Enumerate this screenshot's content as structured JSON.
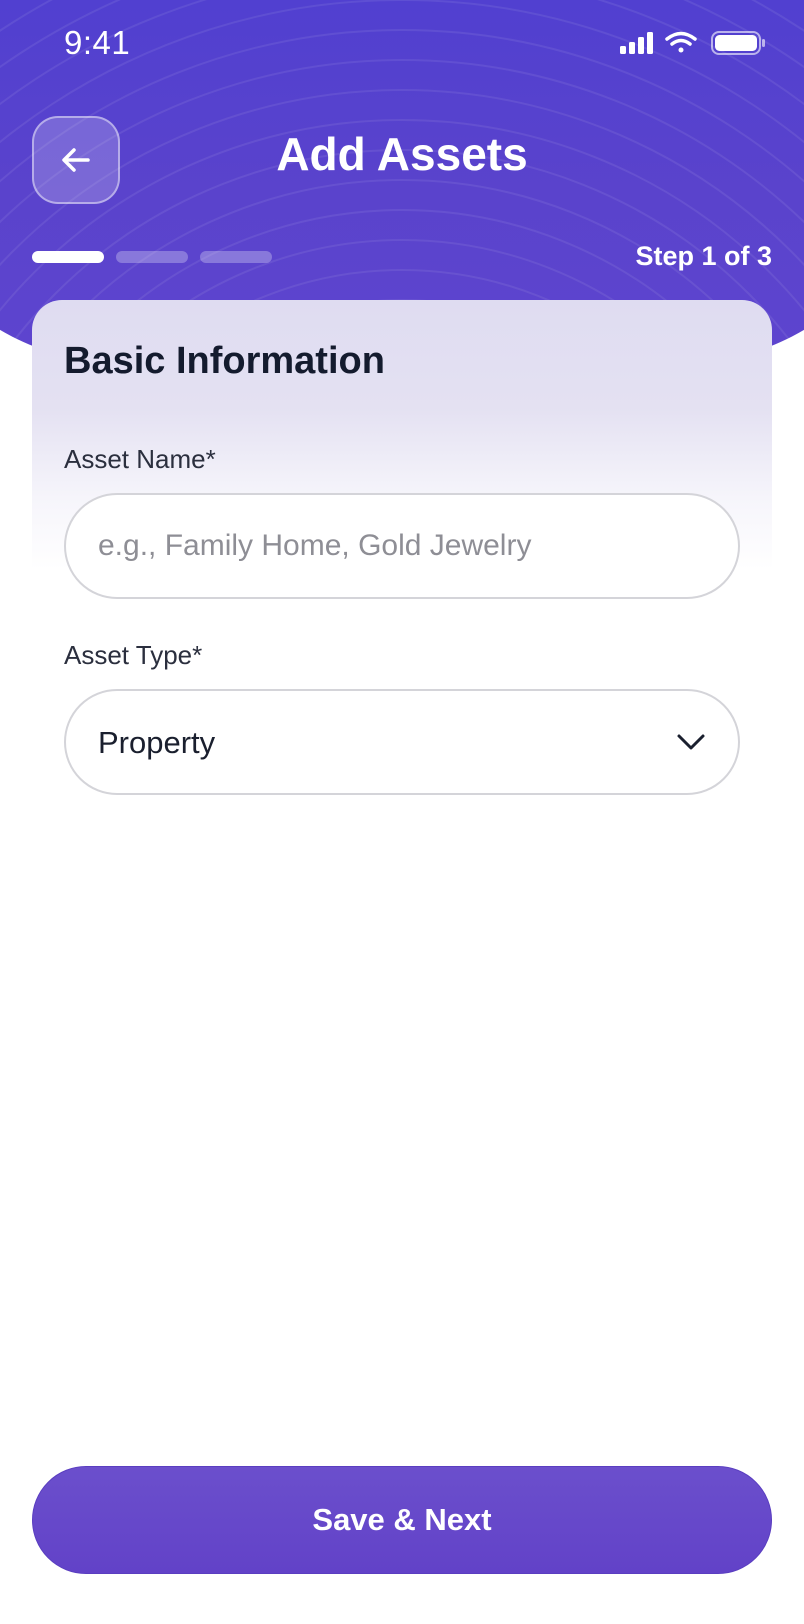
{
  "status_bar": {
    "time": "9:41",
    "icons": [
      "cellular-signal-icon",
      "wifi-icon",
      "battery-icon"
    ]
  },
  "header": {
    "title": "Add Assets",
    "back_icon": "arrow-left-icon",
    "step_label": "Step 1 of 3",
    "progress": {
      "current_step": 1,
      "total_steps": 3
    }
  },
  "form": {
    "section_title": "Basic Information",
    "asset_name": {
      "label": "Asset Name*",
      "value": "",
      "placeholder": "e.g., Family Home, Gold Jewelry"
    },
    "asset_type": {
      "label": "Asset Type*",
      "selected": "Property",
      "icon": "chevron-down-icon"
    }
  },
  "footer": {
    "primary_button": "Save & Next"
  },
  "colors": {
    "header_purple": "#5a43cc",
    "button_purple": "#6647c9",
    "text_dark": "#141b2e",
    "placeholder": "#8e8e95",
    "input_border": "#d4d4d9"
  }
}
